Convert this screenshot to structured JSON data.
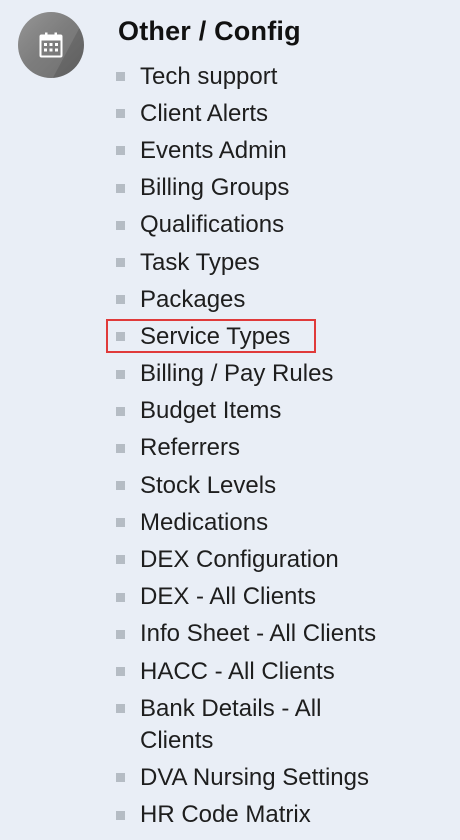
{
  "section": {
    "title": "Other / Config",
    "icon": "calendar-icon",
    "colors": {
      "background": "#e9eef6",
      "icon_bg": "#707070",
      "bullet": "#b5bcc4",
      "highlight": "#e03a3a"
    }
  },
  "menu": {
    "items": [
      {
        "label": "Tech support"
      },
      {
        "label": "Client Alerts"
      },
      {
        "label": "Events Admin"
      },
      {
        "label": "Billing Groups"
      },
      {
        "label": "Qualifications"
      },
      {
        "label": "Task Types"
      },
      {
        "label": "Packages"
      },
      {
        "label": "Service Types",
        "highlighted": true
      },
      {
        "label": "Billing / Pay Rules"
      },
      {
        "label": "Budget Items"
      },
      {
        "label": "Referrers"
      },
      {
        "label": "Stock Levels"
      },
      {
        "label": "Medications"
      },
      {
        "label": "DEX Configuration"
      },
      {
        "label": "DEX - All Clients"
      },
      {
        "label": "Info Sheet - All Clients"
      },
      {
        "label": "HACC - All Clients"
      },
      {
        "label": "Bank Details - All Clients"
      },
      {
        "label": "DVA Nursing Settings"
      },
      {
        "label": "HR Code Matrix"
      }
    ]
  }
}
